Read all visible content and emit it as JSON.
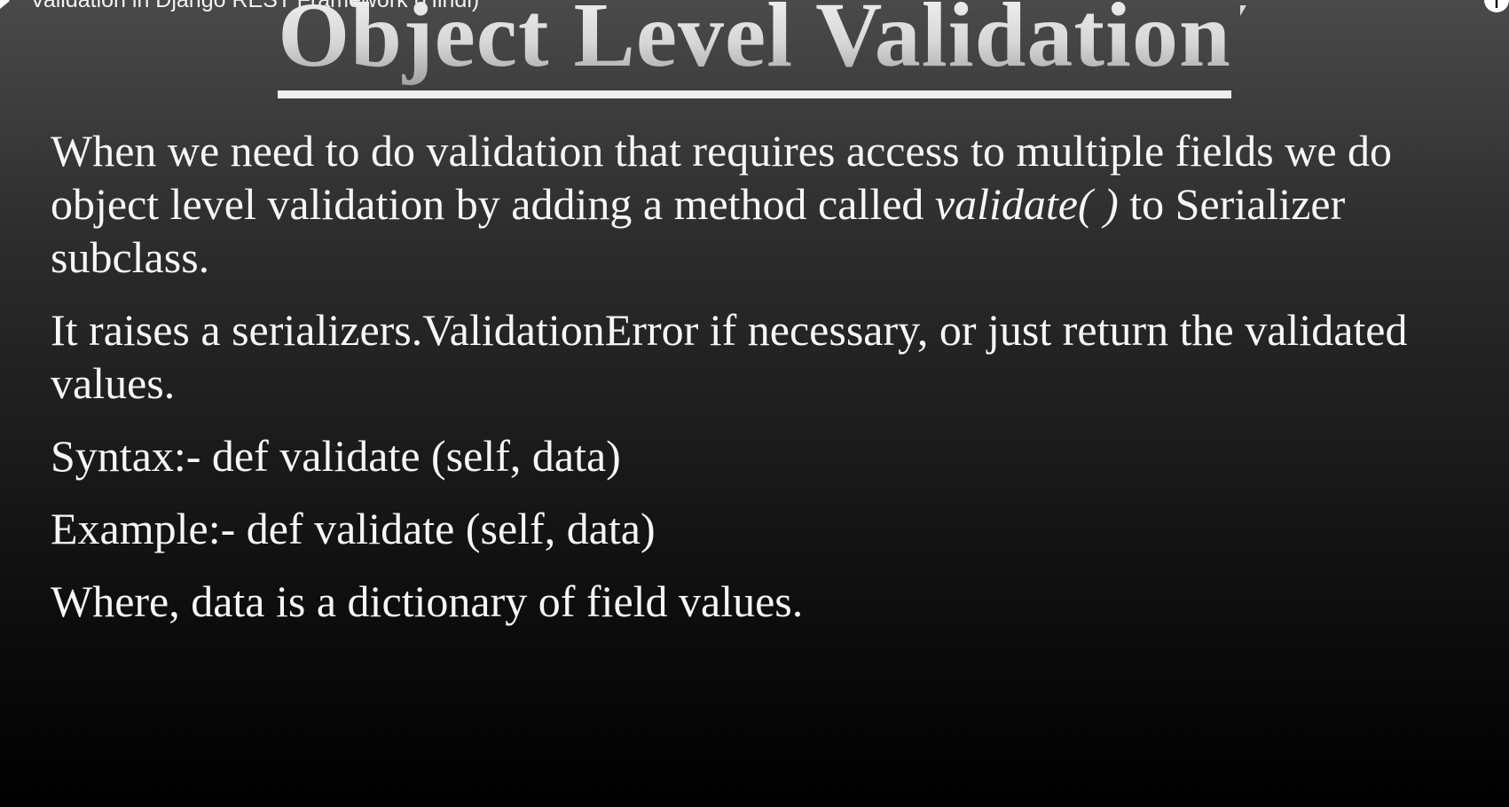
{
  "video": {
    "title": "Validation in Django REST Framework (Hindi)",
    "play_icon": "play-icon",
    "info_icon": "info-icon",
    "info_glyph": "i"
  },
  "slide": {
    "title": "Object Level Validation",
    "paragraph1": {
      "before": "When we need to do validation that requires access to multiple fields we do object level validation by adding a method called ",
      "italic": "validate( )",
      "after": " to Serializer subclass."
    },
    "paragraph2": "It raises a serializers.ValidationError if necessary, or just return the validated values.",
    "syntax": "Syntax:- def validate (self, data)",
    "example": "Example:- def validate (self, data)",
    "where": "Where, data is a dictionary of field values."
  },
  "colors": {
    "text": "#f6f6f6",
    "title_light": "#f4f4f4",
    "title_dark": "#9a9a9a",
    "background_top": "#4a4a4a",
    "background_bottom": "#000000"
  }
}
